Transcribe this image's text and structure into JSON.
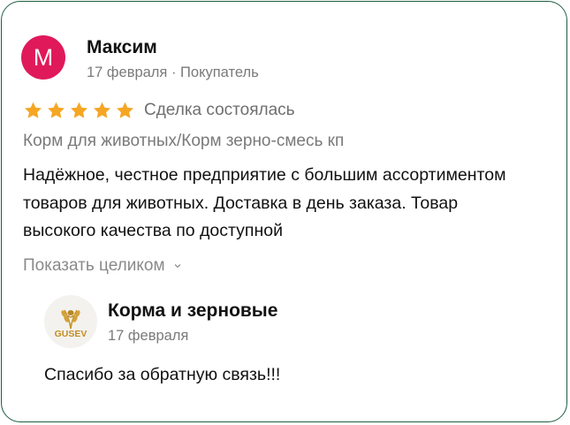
{
  "review": {
    "author": {
      "initial": "М",
      "name": "Максим",
      "meta": "17 февраля · Покупатель",
      "avatar_color": "#e0195b"
    },
    "rating": 5,
    "star_color": "#f5a623",
    "status": "Сделка состоялась",
    "product": "Корм для животных/Корм зерно-смесь кп",
    "text": "Надёжное, честное предприятие с большим ассортиментом товаров для животных. Доставка в день заказа. Товар высокого качества по доступной",
    "show_more": "Показать целиком",
    "show_more_icon": "chevron-down-icon"
  },
  "reply": {
    "logo_text": "GUSEV",
    "name": "Корма и зерновые",
    "date": "17 февраля",
    "text": "Спасибо за обратную связь!!!"
  },
  "colors": {
    "border": "#1d5c3f",
    "muted_text": "#7a7a7a"
  }
}
